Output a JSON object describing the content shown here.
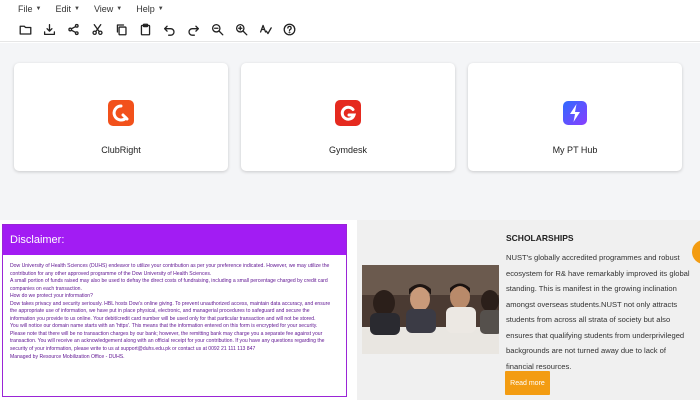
{
  "menu": [
    {
      "label": "File"
    },
    {
      "label": "Edit"
    },
    {
      "label": "View"
    },
    {
      "label": "Help"
    }
  ],
  "toolbar": [
    {
      "icon": "folder-open-icon"
    },
    {
      "icon": "download-icon"
    },
    {
      "icon": "share-icon"
    },
    {
      "icon": "cut-icon"
    },
    {
      "icon": "copy-icon"
    },
    {
      "icon": "paste-icon"
    },
    {
      "icon": "undo-icon"
    },
    {
      "icon": "redo-icon"
    },
    {
      "icon": "zoom-out-icon"
    },
    {
      "icon": "zoom-in-icon"
    },
    {
      "icon": "spell-check-icon"
    },
    {
      "icon": "help-icon"
    }
  ],
  "cards": [
    {
      "name": "ClubRight",
      "icon": "clubright-logo-icon",
      "color": "#f2511b"
    },
    {
      "name": "Gymdesk",
      "icon": "gymdesk-logo-icon",
      "color": "#e52a1f"
    },
    {
      "name": "My PT Hub",
      "icon": "my-pt-hub-logo-icon",
      "color": "#3d5afe"
    }
  ],
  "disclaimer": {
    "title": "Disclaimer:",
    "lines": [
      "Dow University of Health Sciences (DUHS) endeavor to utilize your contribution as per your preference indicated. However, we may utilize the",
      "contribution for any other approved programme of the Dow University of Health Sciences.",
      "A small portion of funds raised may also be used to defray the direct costs of fundraising, including a small percentage charged by credit card",
      "companies on each transaction.",
      "How do we protect your information?",
      "Dow takes privacy and security seriously. HBL hosts Dow's online giving. To prevent unauthorized access, maintain data accuracy, and ensure",
      "the appropriate use of information, we have put in place physical, electronic, and managerial procedures to safeguard and secure the",
      "information you provide to us online. Your debit/credit card number will be used only for that particular transaction and will not be stored.",
      "You will notice our domain name starts with an 'https'. This means that the information entered on this form is encrypted for your security.",
      "Please note that there will be no transaction charges by our bank; however, the remitting bank may charge you a separate fee against your",
      "transaction. You will receive an acknowledgement along with an official receipt for your contribution. If you have any questions regarding the",
      "security of your information, please write to us at support@duhs.edu.pk or contact us at 0092 21 111 113 847",
      "Managed by Resource Mobilization Office - DUHS."
    ]
  },
  "scholarships": {
    "title": "SCHOLARSHIPS",
    "text": "NUST's globally accredited programmes and robust ecosystem for R& have remarkably improved its global standing. This is manifest in the growing inclination amongst overseas students.NUST not only attracts students from across all strata of society but also ensures that qualifying students from underprivileged backgrounds are not turned away due to lack of financial resources.",
    "button_label": "Read more",
    "accent": "#f39c12"
  },
  "colors": {
    "disclaimer_header": "#a21cf3",
    "disclaimer_text": "#5d1190"
  }
}
